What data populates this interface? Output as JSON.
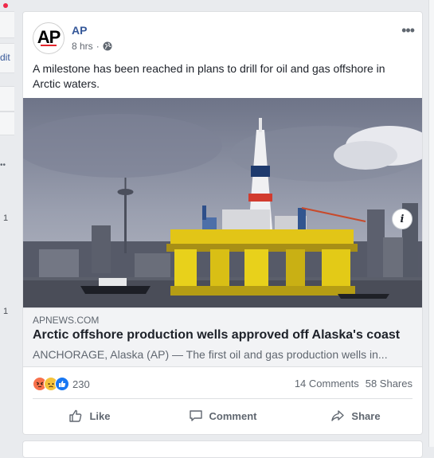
{
  "left_strip": {
    "edit_label": "dit",
    "count_1": "1",
    "count_2": "1"
  },
  "post": {
    "author": "AP",
    "time": "8 hrs",
    "separator": "·",
    "text": "A milestone has been reached in plans to drill for oil and gas offshore in Arctic waters.",
    "more_label": "•••",
    "info_label": "i"
  },
  "link": {
    "domain": "APNEWS.COM",
    "title": "Arctic offshore production wells approved off Alaska's coast",
    "description": "ANCHORAGE, Alaska (AP) — The first oil and gas production wells in..."
  },
  "engagement": {
    "reactions": [
      "angry",
      "sad",
      "like"
    ],
    "reaction_count": "230",
    "comments": "14 Comments",
    "shares": "58 Shares"
  },
  "actions": {
    "like": "Like",
    "comment": "Comment",
    "share": "Share"
  },
  "colors": {
    "brand_link": "#365899",
    "angry": "#f7714c",
    "sad": "#f5c33b",
    "like": "#1877f2"
  }
}
